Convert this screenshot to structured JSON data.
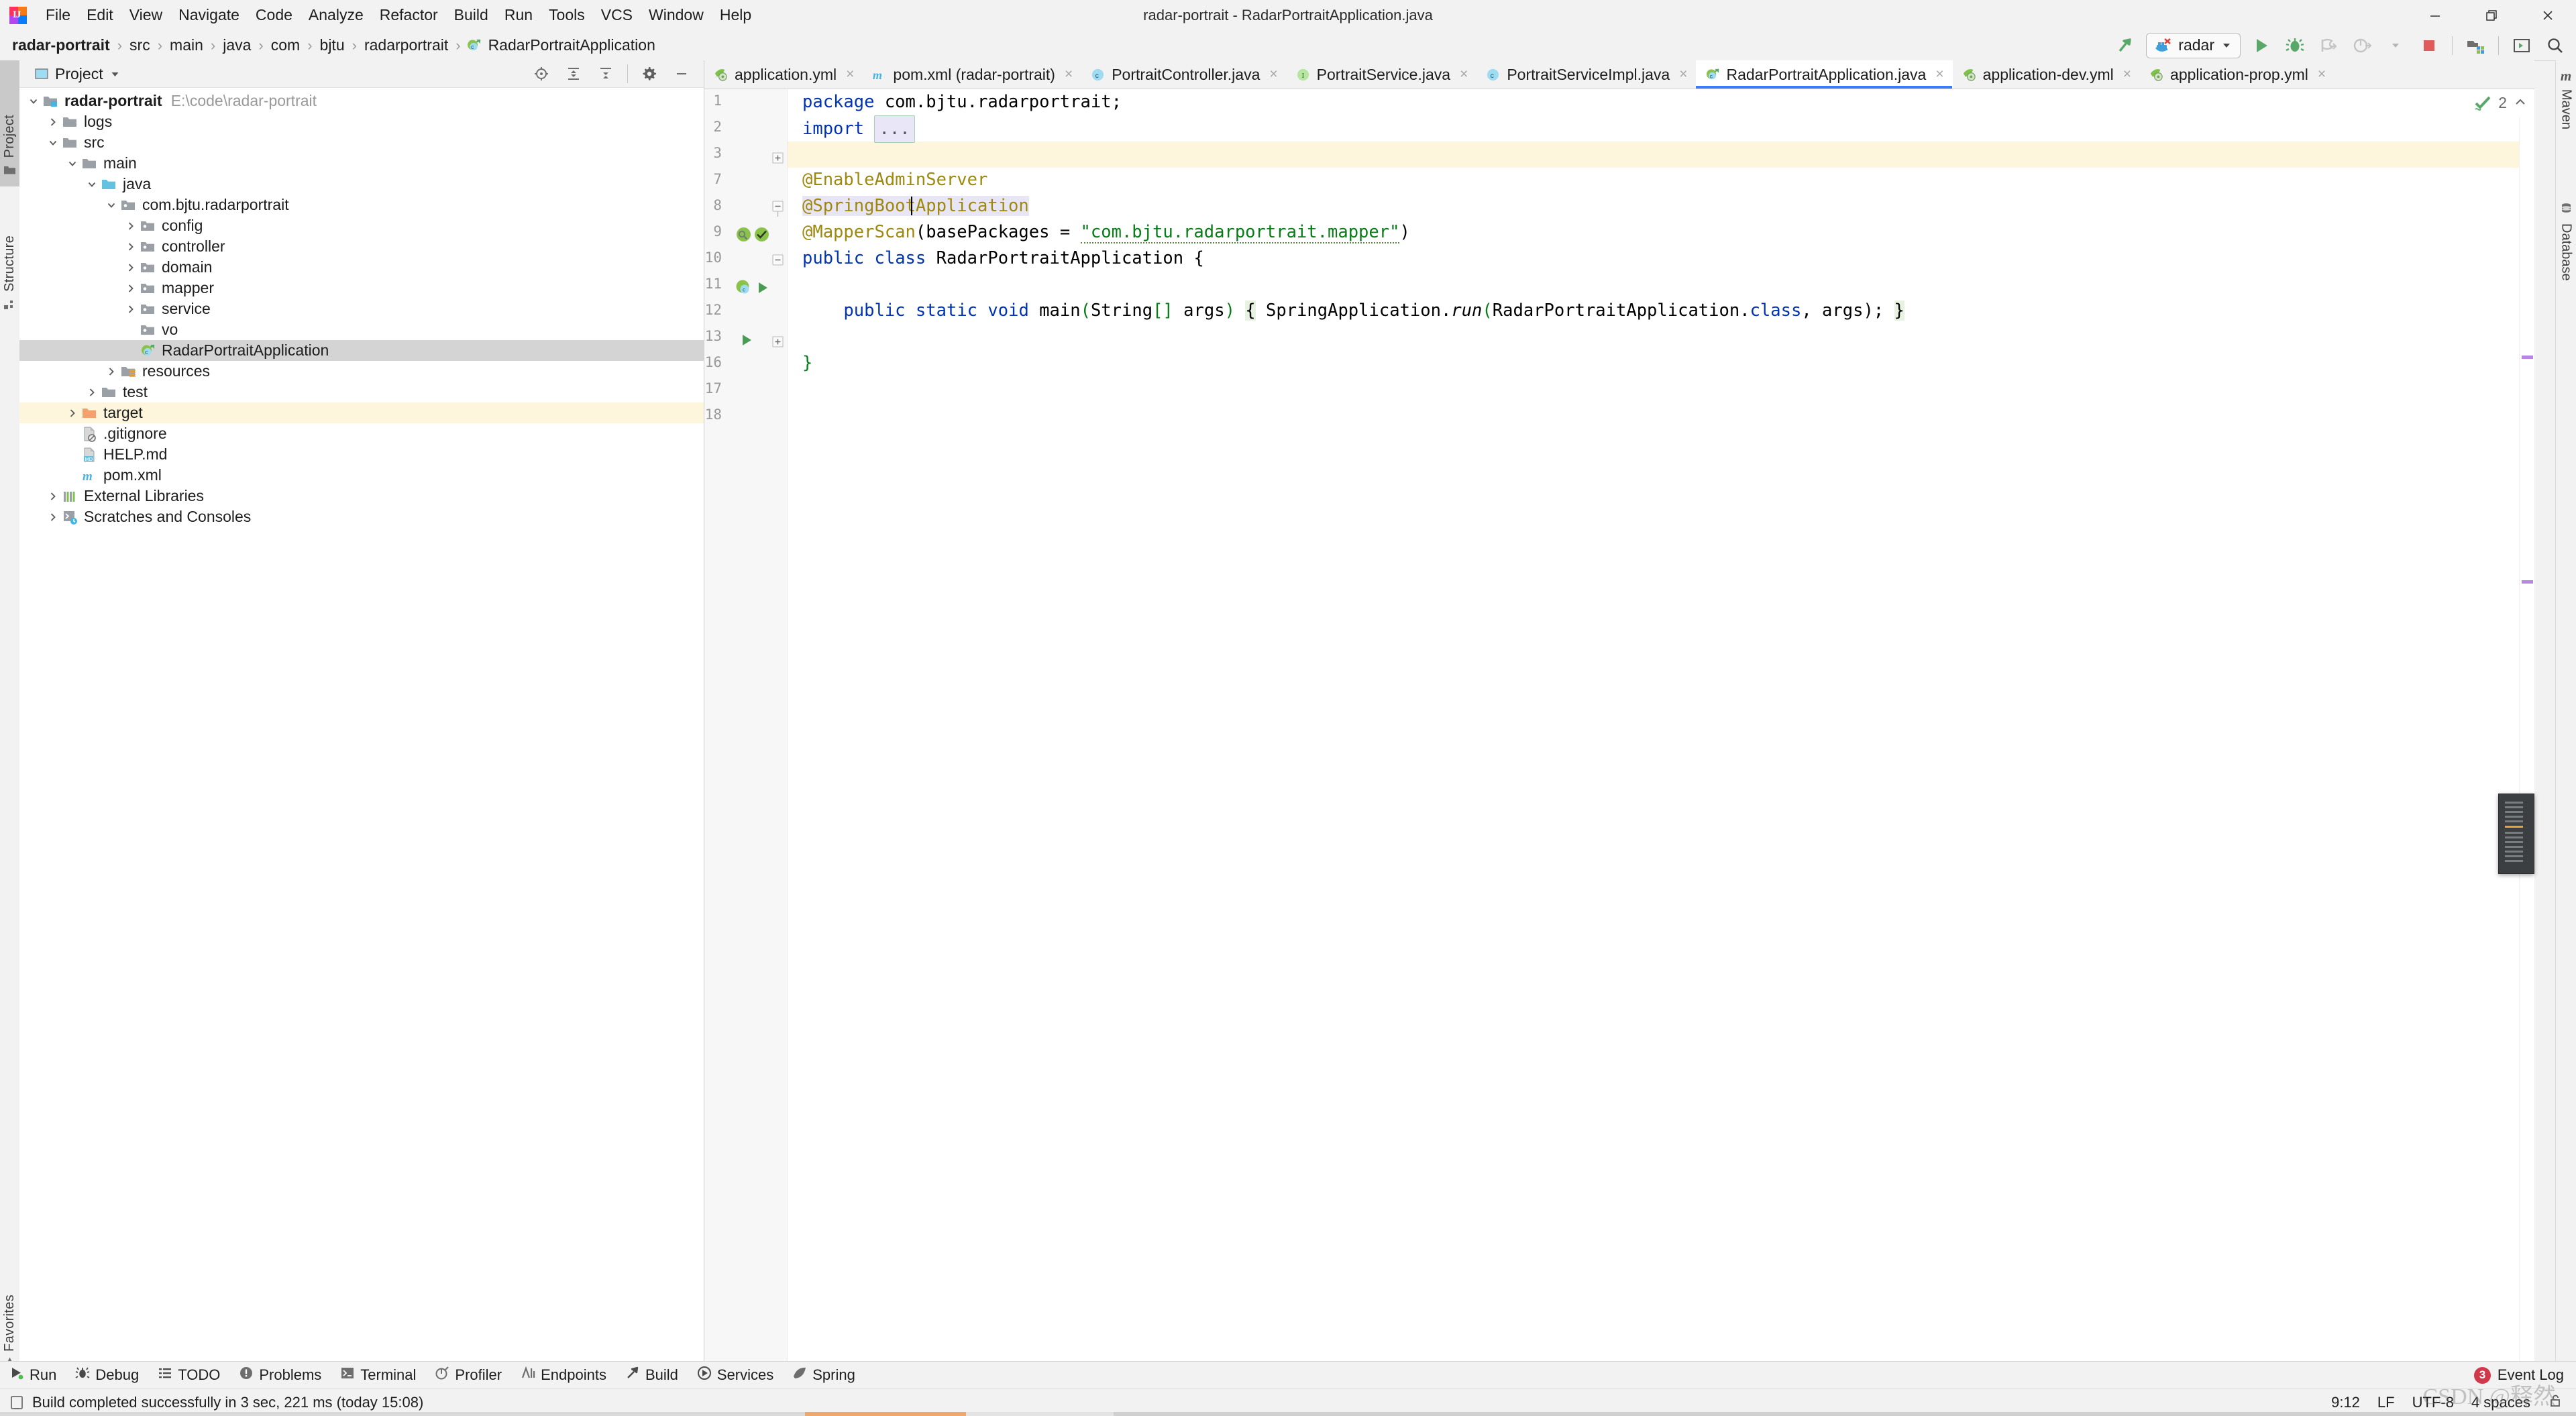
{
  "window": {
    "title": "radar-portrait - RadarPortraitApplication.java",
    "minimize": "minimize-icon",
    "restore": "restore-icon",
    "close": "close-icon"
  },
  "menu": {
    "items": [
      {
        "label": "File"
      },
      {
        "label": "Edit"
      },
      {
        "label": "View"
      },
      {
        "label": "Navigate"
      },
      {
        "label": "Code"
      },
      {
        "label": "Analyze"
      },
      {
        "label": "Refactor"
      },
      {
        "label": "Build"
      },
      {
        "label": "Run"
      },
      {
        "label": "Tools"
      },
      {
        "label": "VCS"
      },
      {
        "label": "Window"
      },
      {
        "label": "Help"
      }
    ]
  },
  "breadcrumb": {
    "items": [
      {
        "label": "radar-portrait",
        "bold": true,
        "icon": ""
      },
      {
        "label": "src",
        "bold": false,
        "icon": ""
      },
      {
        "label": "main",
        "bold": false,
        "icon": ""
      },
      {
        "label": "java",
        "bold": false,
        "icon": ""
      },
      {
        "label": "com",
        "bold": false,
        "icon": ""
      },
      {
        "label": "bjtu",
        "bold": false,
        "icon": ""
      },
      {
        "label": "radarportrait",
        "bold": false,
        "icon": ""
      },
      {
        "label": "RadarPortraitApplication",
        "bold": false,
        "icon": "spring-class-icon"
      }
    ],
    "separator": "›"
  },
  "toolbar": {
    "build_label": "build-hammer-icon",
    "run_config_name": "radar",
    "run_config_icon": "docker-icon",
    "dropdown_icon": "chevron-down-icon",
    "run_icon": "run-icon",
    "debug_icon": "debug-icon",
    "run_coverage_icon": "run-with-coverage-icon",
    "profile_icon": "profile-icon",
    "profile_dropdown_icon": "chevron-down-icon",
    "stop_icon": "stop-icon",
    "update_folder_icon": "update-project-icon",
    "tool_window_icon": "open-tool-window-icon",
    "search_icon": "search-everywhere-icon"
  },
  "left_tool_strip": {
    "buttons": [
      {
        "label": "Project",
        "icon": "project-folder-icon",
        "active": true
      },
      {
        "label": "Structure",
        "icon": "structure-icon",
        "active": false
      },
      {
        "label": "Favorites",
        "icon": "star-icon",
        "active": false
      }
    ]
  },
  "right_tool_strip": {
    "buttons": [
      {
        "label": "Maven",
        "icon": "maven-icon"
      },
      {
        "label": "Database",
        "icon": "database-icon"
      }
    ]
  },
  "project_panel": {
    "title": "Project",
    "title_icon": "project-view-icon",
    "title_dropdown": "chevron-down-icon",
    "actions": [
      {
        "name": "locate-icon"
      },
      {
        "name": "expand-all-icon"
      },
      {
        "name": "collapse-all-icon"
      },
      {
        "name": "settings-gear-icon"
      },
      {
        "name": "hide-icon"
      }
    ],
    "tree": [
      {
        "label": "radar-portrait",
        "path": "E:\\code\\radar-portrait",
        "depth": 0,
        "twist": "down",
        "icon": "module-icon",
        "bold": true,
        "state": ""
      },
      {
        "label": "logs",
        "path": "",
        "depth": 1,
        "twist": "right",
        "icon": "folder-icon",
        "bold": false,
        "state": ""
      },
      {
        "label": "src",
        "path": "",
        "depth": 1,
        "twist": "down",
        "icon": "folder-icon",
        "bold": false,
        "state": ""
      },
      {
        "label": "main",
        "path": "",
        "depth": 2,
        "twist": "down",
        "icon": "folder-icon",
        "bold": false,
        "state": ""
      },
      {
        "label": "java",
        "path": "",
        "depth": 3,
        "twist": "down",
        "icon": "source-root-icon",
        "bold": false,
        "state": ""
      },
      {
        "label": "com.bjtu.radarportrait",
        "path": "",
        "depth": 4,
        "twist": "down",
        "icon": "package-icon",
        "bold": false,
        "state": ""
      },
      {
        "label": "config",
        "path": "",
        "depth": 5,
        "twist": "right",
        "icon": "package-icon",
        "bold": false,
        "state": ""
      },
      {
        "label": "controller",
        "path": "",
        "depth": 5,
        "twist": "right",
        "icon": "package-icon",
        "bold": false,
        "state": ""
      },
      {
        "label": "domain",
        "path": "",
        "depth": 5,
        "twist": "right",
        "icon": "package-icon",
        "bold": false,
        "state": ""
      },
      {
        "label": "mapper",
        "path": "",
        "depth": 5,
        "twist": "right",
        "icon": "package-icon",
        "bold": false,
        "state": ""
      },
      {
        "label": "service",
        "path": "",
        "depth": 5,
        "twist": "right",
        "icon": "package-icon",
        "bold": false,
        "state": ""
      },
      {
        "label": "vo",
        "path": "",
        "depth": 5,
        "twist": "none",
        "icon": "package-icon",
        "bold": false,
        "state": ""
      },
      {
        "label": "RadarPortraitApplication",
        "path": "",
        "depth": 5,
        "twist": "none",
        "icon": "spring-class-icon",
        "bold": false,
        "state": "selected"
      },
      {
        "label": "resources",
        "path": "",
        "depth": 4,
        "twist": "right",
        "icon": "resource-root-icon",
        "bold": false,
        "state": ""
      },
      {
        "label": "test",
        "path": "",
        "depth": 3,
        "twist": "right",
        "icon": "folder-icon",
        "bold": false,
        "state": ""
      },
      {
        "label": "target",
        "path": "",
        "depth": 2,
        "twist": "right",
        "icon": "excluded-folder-icon",
        "bold": false,
        "state": "highlight"
      },
      {
        "label": ".gitignore",
        "path": "",
        "depth": 2,
        "twist": "none",
        "icon": "gitignore-file-icon",
        "bold": false,
        "state": ""
      },
      {
        "label": "HELP.md",
        "path": "",
        "depth": 2,
        "twist": "none",
        "icon": "markdown-file-icon",
        "bold": false,
        "state": ""
      },
      {
        "label": "pom.xml",
        "path": "",
        "depth": 2,
        "twist": "none",
        "icon": "maven-pom-icon",
        "bold": false,
        "state": ""
      },
      {
        "label": "External Libraries",
        "path": "",
        "depth": 1,
        "twist": "right",
        "icon": "libraries-icon",
        "bold": false,
        "state": ""
      },
      {
        "label": "Scratches and Consoles",
        "path": "",
        "depth": 1,
        "twist": "right",
        "icon": "scratches-icon",
        "bold": false,
        "state": ""
      }
    ]
  },
  "editor": {
    "tabs": [
      {
        "label": "application.yml",
        "icon": "spring-yaml-icon",
        "active": false
      },
      {
        "label": "pom.xml (radar-portrait)",
        "icon": "maven-pom-icon",
        "active": false
      },
      {
        "label": "PortraitController.java",
        "icon": "java-class-icon",
        "active": false
      },
      {
        "label": "PortraitService.java",
        "icon": "java-interface-icon",
        "active": false
      },
      {
        "label": "PortraitServiceImpl.java",
        "icon": "java-class-icon",
        "active": false
      },
      {
        "label": "RadarPortraitApplication.java",
        "icon": "spring-class-icon",
        "active": true
      },
      {
        "label": "application-dev.yml",
        "icon": "spring-yaml-icon",
        "active": false
      },
      {
        "label": "application-prop.yml",
        "icon": "spring-yaml-icon",
        "active": false
      }
    ],
    "close_glyph": "×",
    "inspection": {
      "icon": "inspection-ok-icon",
      "count": "2",
      "chevron": "chevron-up-icon"
    },
    "line_numbers": [
      "1",
      "2",
      "3",
      "7",
      "8",
      "9",
      "10",
      "11",
      "12",
      "13",
      "16",
      "17",
      "18"
    ],
    "code": {
      "l1_kw": "package",
      "l1_rest": " com.bjtu.radarportrait;",
      "l3_kw": "import",
      "l3_placeholder": "...",
      "l8": "@EnableAdminServer",
      "l9": "@SpringBootApplication",
      "l10_ann": "@MapperScan",
      "l10_open": "(basePackages = ",
      "l10_str": "\"com.bjtu.radarportrait.mapper\"",
      "l10_close": ")",
      "l11_kw1": "public",
      "l11_kw2": "class",
      "l11_name": "RadarPortraitApplication",
      "l11_brace": "{",
      "l13_kw1": "public",
      "l13_kw2": "static",
      "l13_kw3": "void",
      "l13_name": "main",
      "l13_params_open": "(",
      "l13_type": "String",
      "l13_brackets": "[]",
      "l13_arg": " args",
      "l13_params_close": ")",
      "l13_body_open": "{",
      "l13_call_obj": " SpringApplication.",
      "l13_call_fn": "run",
      "l13_call_open": "(",
      "l13_call_cls": "RadarPortraitApplication.",
      "l13_class_kw": "class",
      "l13_call_args": ", args);",
      "l13_body_close": "}",
      "l17": "}"
    },
    "gutter_icons": {
      "line9_bean": "spring-bean-search-icon",
      "line9_check": "spring-config-ok-icon",
      "line11_bean": "spring-bean-icon",
      "line11_run": "run-gutter-icon",
      "line13_run": "run-gutter-icon",
      "line3_fold": "fold-expand-icon",
      "line8_fold": "fold-collapse-icon",
      "line10_fold": "fold-collapse-icon",
      "line13_fold": "fold-expand-icon"
    }
  },
  "tool_windows": {
    "buttons": [
      {
        "label": "Run",
        "icon": "run-icon"
      },
      {
        "label": "Debug",
        "icon": "debug-icon"
      },
      {
        "label": "TODO",
        "icon": "todo-icon"
      },
      {
        "label": "Problems",
        "icon": "problems-icon"
      },
      {
        "label": "Terminal",
        "icon": "terminal-icon"
      },
      {
        "label": "Profiler",
        "icon": "profiler-icon"
      },
      {
        "label": "Endpoints",
        "icon": "endpoints-icon"
      },
      {
        "label": "Build",
        "icon": "build-hammer-icon"
      },
      {
        "label": "Services",
        "icon": "services-icon"
      },
      {
        "label": "Spring",
        "icon": "spring-leaf-icon"
      }
    ],
    "event_log": {
      "label": "Event Log",
      "count": "3"
    }
  },
  "status_bar": {
    "message": "Build completed successfully in 3 sec, 221 ms (today 15:08)",
    "message_icon": "build-status-icon",
    "position": "9:12",
    "line_separator": "LF",
    "encoding": "UTF-8",
    "indent": "4 spaces",
    "lock_icon": "unlocked-icon"
  },
  "watermark": "CSDN @释然"
}
